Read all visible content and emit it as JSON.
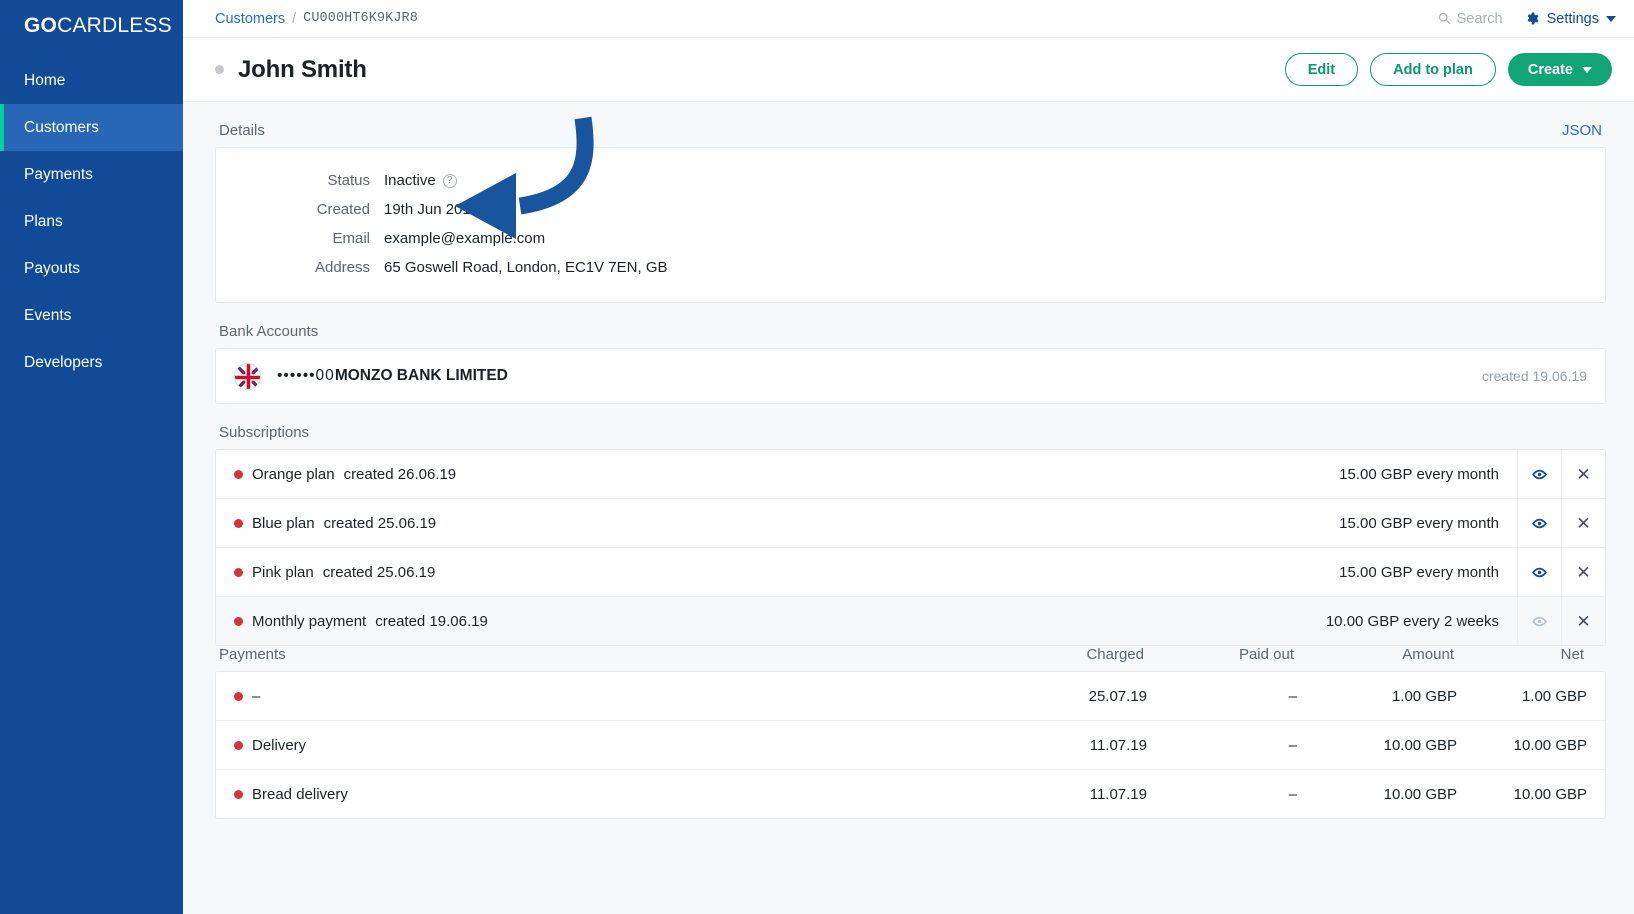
{
  "brand": {
    "bold": "GO",
    "light": "CARDLESS"
  },
  "sidebar": {
    "items": [
      {
        "label": "Home"
      },
      {
        "label": "Customers"
      },
      {
        "label": "Payments"
      },
      {
        "label": "Plans"
      },
      {
        "label": "Payouts"
      },
      {
        "label": "Events"
      },
      {
        "label": "Developers"
      }
    ],
    "active_index": 1,
    "bg_color": "#114b97",
    "active_bg_color": "#2767b5",
    "active_marker_color": "#00d09b"
  },
  "topbar": {
    "breadcrumb_parent": "Customers",
    "breadcrumb_separator": "/",
    "breadcrumb_current": "CU000HT6K9KJR8",
    "search_placeholder": "Search",
    "search_icon": "search-icon",
    "settings_label": "Settings",
    "settings_icon": "gear-icon",
    "settings_caret": "chevron-down-icon"
  },
  "pagehead": {
    "status_dot_color": "#c3c8cd",
    "title": "John Smith",
    "buttons": {
      "edit": "Edit",
      "add_to_plan": "Add to plan",
      "create": "Create"
    },
    "accent_green": "#11a575"
  },
  "details": {
    "section_title": "Details",
    "json_link": "JSON",
    "rows": [
      {
        "label": "Status",
        "value": "Inactive",
        "help_icon": "question-mark-icon"
      },
      {
        "label": "Created",
        "value": "19th Jun 2019"
      },
      {
        "label": "Email",
        "value": "example@example.com"
      },
      {
        "label": "Address",
        "value": "65 Goswell Road, London, EC1V 7EN, GB"
      }
    ]
  },
  "bank_accounts": {
    "section_title": "Bank Accounts",
    "rows": [
      {
        "flag_icon": "uk-flag-icon",
        "mask": "••••••00",
        "bank_name": "MONZO BANK LIMITED",
        "created": "created 19.06.19"
      }
    ]
  },
  "subscriptions": {
    "section_title": "Subscriptions",
    "rows": [
      {
        "dot_color": "#d5343a",
        "name": "Orange plan",
        "created": "created 26.06.19",
        "amount": "15.00 GBP every month",
        "view_icon": "eye-icon",
        "cancel_icon": "close-icon",
        "dim": false
      },
      {
        "dot_color": "#d5343a",
        "name": "Blue plan",
        "created": "created 25.06.19",
        "amount": "15.00 GBP every month",
        "view_icon": "eye-icon",
        "cancel_icon": "close-icon",
        "dim": false
      },
      {
        "dot_color": "#d5343a",
        "name": "Pink plan",
        "created": "created 25.06.19",
        "amount": "15.00 GBP every month",
        "view_icon": "eye-icon",
        "cancel_icon": "close-icon",
        "dim": false
      },
      {
        "dot_color": "#d5343a",
        "name": "Monthly payment",
        "created": "created 19.06.19",
        "amount": "10.00 GBP every 2 weeks",
        "view_icon": "eye-icon",
        "cancel_icon": "close-icon",
        "dim": true
      }
    ]
  },
  "payments": {
    "section_title": "Payments",
    "columns": [
      "Charged",
      "Paid out",
      "Amount",
      "Net"
    ],
    "rows": [
      {
        "dot_color": "#d5343a",
        "name": "–",
        "charged": "25.07.19",
        "paid_out": "–",
        "amount": "1.00 GBP",
        "net": "1.00 GBP"
      },
      {
        "dot_color": "#d5343a",
        "name": "Delivery",
        "charged": "11.07.19",
        "paid_out": "–",
        "amount": "10.00 GBP",
        "net": "10.00 GBP"
      },
      {
        "dot_color": "#d5343a",
        "name": "Bread delivery",
        "charged": "11.07.19",
        "paid_out": "–",
        "amount": "10.00 GBP",
        "net": "10.00 GBP"
      }
    ]
  },
  "annotation": {
    "arrow_color": "#18559e",
    "points_at": "Status value"
  }
}
